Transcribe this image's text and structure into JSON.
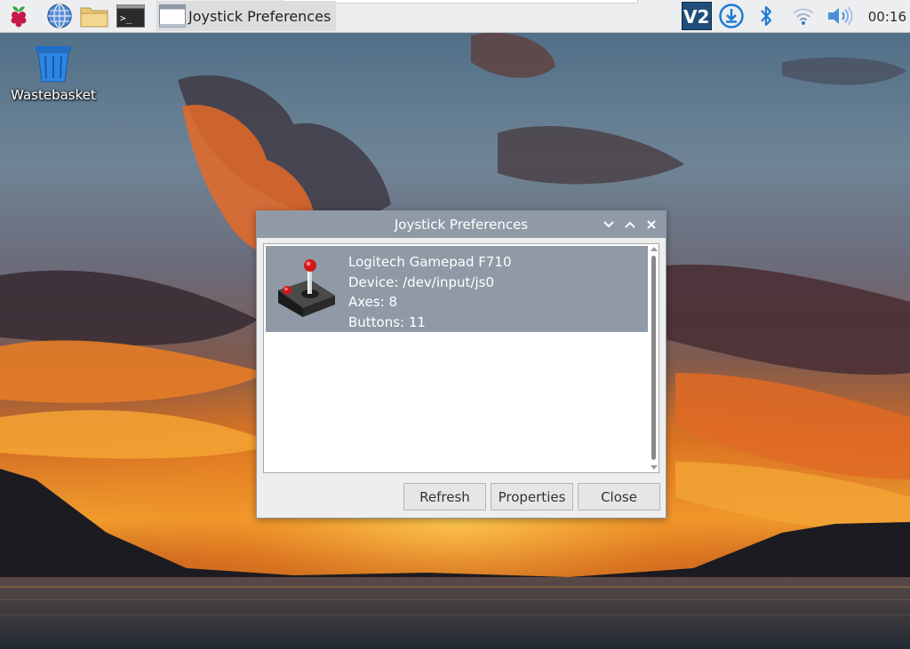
{
  "taskbar": {
    "launchers": [
      {
        "name": "raspberry-menu",
        "icon": "raspberry-icon"
      },
      {
        "name": "web-browser",
        "icon": "globe-icon"
      },
      {
        "name": "file-manager",
        "icon": "folder-icon"
      },
      {
        "name": "terminal",
        "icon": "terminal-icon"
      }
    ],
    "task_button_label": "Joystick Preferences",
    "tray": {
      "icons": [
        "vnc-icon",
        "download-icon",
        "bluetooth-icon",
        "wifi-icon",
        "volume-icon"
      ],
      "clock": "00:16"
    }
  },
  "desktop": {
    "icons": [
      {
        "label": "Wastebasket",
        "icon": "wastebasket-icon"
      }
    ]
  },
  "dialog": {
    "title": "Joystick Preferences",
    "controls": [
      "minimize-icon",
      "maximize-icon",
      "close-icon"
    ],
    "devices": [
      {
        "name": "Logitech Gamepad F710",
        "device": "Device: /dev/input/js0",
        "axes": "Axes: 8",
        "buttons": "Buttons: 11",
        "selected": true
      }
    ],
    "buttons": {
      "refresh": "Refresh",
      "properties": "Properties",
      "close": "Close"
    }
  },
  "colors": {
    "taskbar_bg": "#edeeef",
    "titlebar_bg": "#8f9aa6",
    "selection_bg": "#8f9aa6",
    "dialog_bg": "#eeeeee",
    "vnc_accent": "#1f4e7a",
    "tray_blue": "#1f7bd6"
  }
}
